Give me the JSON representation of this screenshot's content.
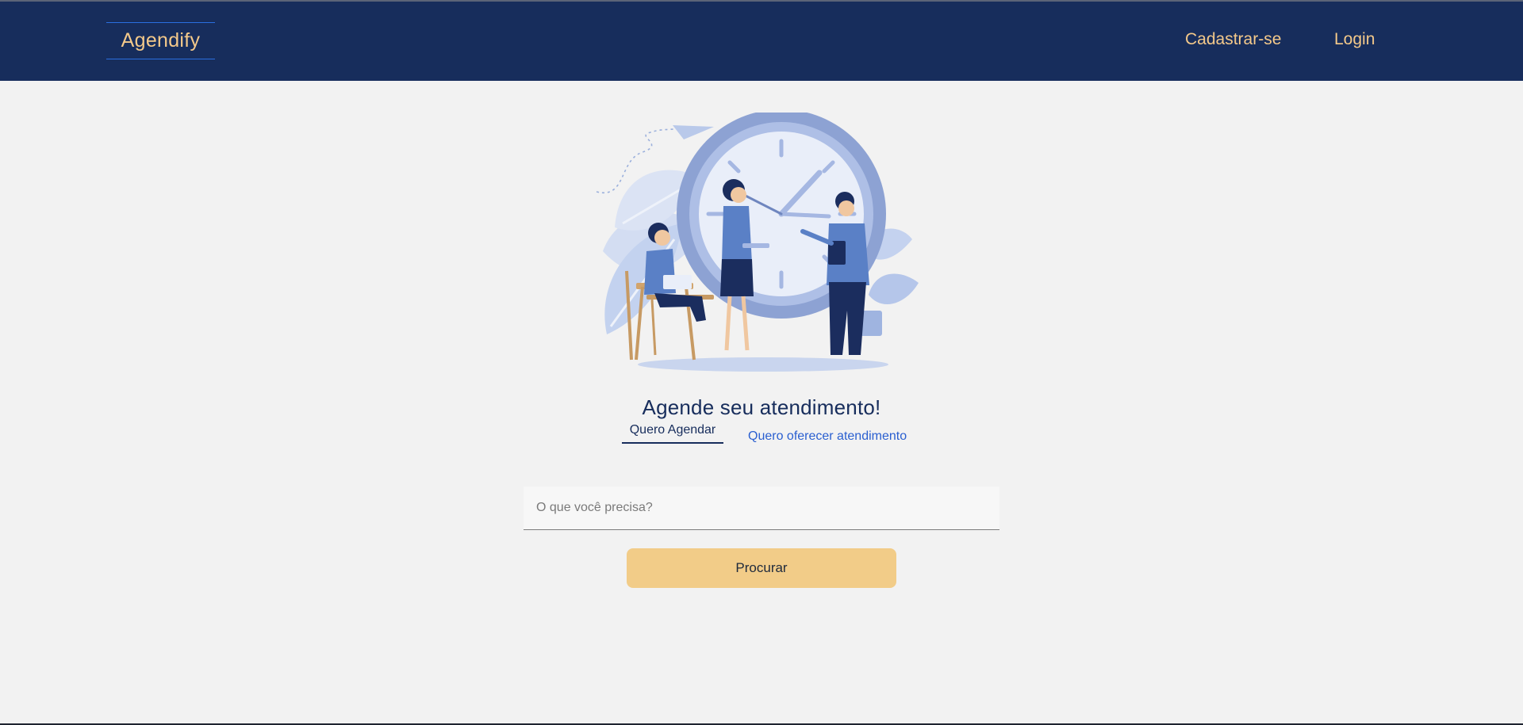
{
  "navbar": {
    "brand": "Agendify",
    "links": {
      "register": "Cadastrar-se",
      "login": "Login"
    }
  },
  "main": {
    "headline": "Agende seu atendimento!",
    "tabs": {
      "active": "Quero Agendar",
      "inactive": "Quero oferecer atendimento"
    },
    "search": {
      "placeholder": "O que você precisa?",
      "value": ""
    },
    "search_button": "Procurar"
  },
  "colors": {
    "navbar_bg": "#172d5c",
    "brand_accent": "#f4c98a",
    "button_bg": "#f2cc88",
    "page_bg": "#f2f2f2",
    "link_blue": "#2a5fd0"
  },
  "illustration": {
    "name": "scheduling-illustration"
  }
}
